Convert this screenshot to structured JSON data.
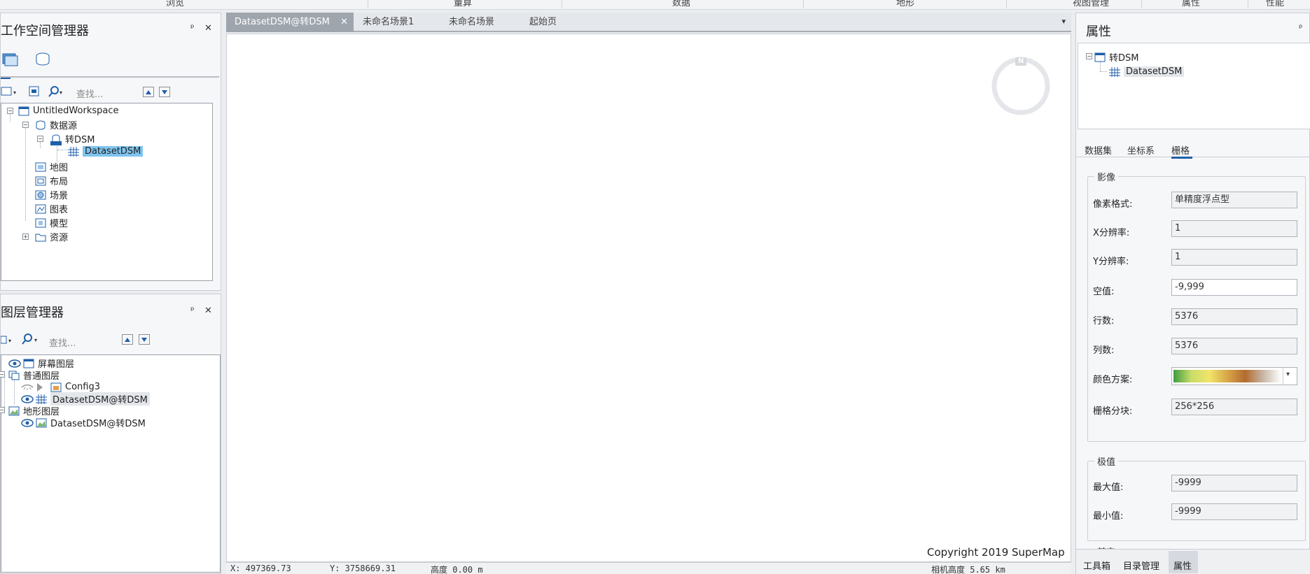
{
  "ribbon": {
    "items": [
      "浏览",
      "量算",
      "数据",
      "地形",
      "视图管理",
      "属性",
      "性能"
    ]
  },
  "workspace": {
    "title": "工作空间管理器",
    "pin": "ᵖ",
    "close": "✕",
    "search_placeholder": "查找...",
    "tree": {
      "root": "UntitledWorkspace",
      "datasources": "数据源",
      "datasource": "转DSM",
      "dataset": "DatasetDSM",
      "maps": "地图",
      "layouts": "布局",
      "scenes": "场景",
      "charts": "图表",
      "models": "模型",
      "resources": "资源"
    }
  },
  "layers": {
    "title": "图层管理器",
    "pin": "ᵖ",
    "close": "✕",
    "search_placeholder": "查找...",
    "tree": {
      "screen_layer": "屏幕图层",
      "normal_layer": "普通图层",
      "config": "Config3",
      "dataset_layer": "DatasetDSM@转DSM",
      "terrain_layer": "地形图层",
      "terrain_dataset": "DatasetDSM@转DSM"
    }
  },
  "tabs": [
    {
      "label": "DatasetDSM@转DSM",
      "close": "✕",
      "active": true
    },
    {
      "label": "未命名场景1",
      "active": false
    },
    {
      "label": "未命名场景",
      "active": false
    },
    {
      "label": "起始页",
      "active": false
    }
  ],
  "tabs_menu": "▾",
  "scene": {
    "compass_n": "N",
    "copyright": "Copyright 2019 SuperMap"
  },
  "status": {
    "x": "X: 497369.73",
    "y": "Y: 3758669.31",
    "height": "高度 0.00 m",
    "camera": "相机高度 5.65 km"
  },
  "properties": {
    "title": "属性",
    "pin": "ᵖ",
    "tree_root": "转DSM",
    "tree_child": "DatasetDSM",
    "tabs": [
      "数据集",
      "坐标系",
      "栅格"
    ],
    "active_tab": "栅格",
    "image_group": {
      "legend": "影像",
      "rows": [
        {
          "label": "像素格式:",
          "value": "单精度浮点型",
          "editable": false
        },
        {
          "label": "X分辨率:",
          "value": "1",
          "editable": false
        },
        {
          "label": "Y分辨率:",
          "value": "1",
          "editable": false
        },
        {
          "label": "空值:",
          "value": "-9,999",
          "editable": true
        },
        {
          "label": "行数:",
          "value": "5376",
          "editable": false
        },
        {
          "label": "列数:",
          "value": "5376",
          "editable": false
        },
        {
          "label": "颜色方案:",
          "value": "",
          "editable": true
        },
        {
          "label": "栅格分块:",
          "value": "256*256",
          "editable": false
        }
      ]
    },
    "extreme_group": {
      "legend": "极值",
      "rows": [
        {
          "label": "最大值:",
          "value": "-9999"
        },
        {
          "label": "最小值:",
          "value": "-9999"
        }
      ]
    },
    "other_legend": "其它",
    "bottom_tabs": [
      "工具箱",
      "目录管理",
      "属性"
    ],
    "active_bottom_tab": "属性"
  }
}
